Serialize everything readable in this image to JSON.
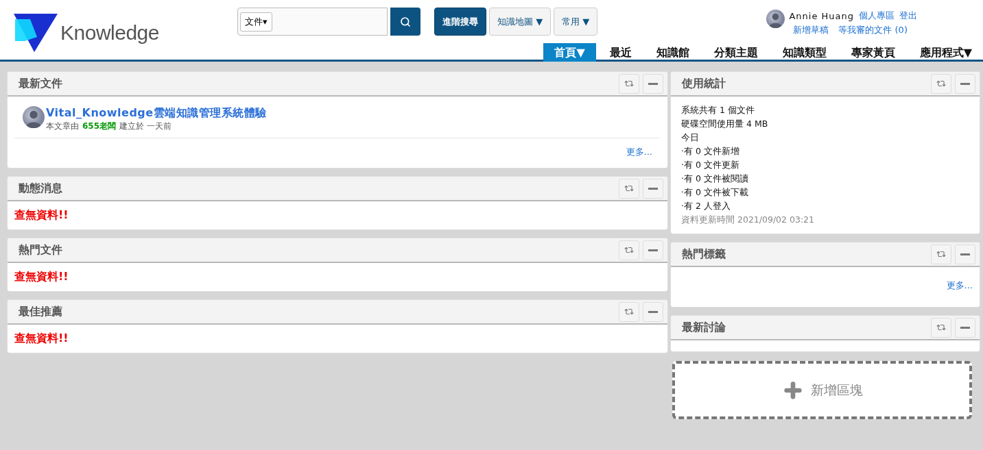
{
  "header": {
    "logo_text": "Knowledge",
    "search": {
      "scope": "文件▾"
    },
    "buttons": [
      {
        "label": "進階搜尋",
        "kind": "primary"
      },
      {
        "label": "知識地圖 ▼",
        "kind": "dropdown"
      },
      {
        "label": "常用 ▼",
        "kind": "dropdown"
      }
    ],
    "user": {
      "name": "Annie Huang",
      "links": [
        "個人專區",
        "登出"
      ],
      "links2": [
        "新增草稿",
        "等我審的文件 (0)"
      ]
    },
    "nav": [
      {
        "label": "首頁▼",
        "selected": true
      },
      {
        "label": "最近",
        "selected": false
      },
      {
        "label": "知識館",
        "selected": false
      },
      {
        "label": "分類主題",
        "selected": false
      },
      {
        "label": "知識類型",
        "selected": false
      },
      {
        "label": "專家黃頁",
        "selected": false
      },
      {
        "label": "應用程式▼",
        "selected": false
      }
    ]
  },
  "left_panels": [
    {
      "title": "最新文件",
      "kind": "documents",
      "documents": [
        {
          "title": "Vital_Knowledge雲端知識管理系統體驗",
          "by": "本文章由",
          "author": "655老闆",
          "created": "建立於 一天前"
        }
      ],
      "more": "更多..."
    },
    {
      "title": "動態消息",
      "kind": "empty",
      "message": "查無資料!!"
    },
    {
      "title": "熱門文件",
      "kind": "empty",
      "message": "查無資料!!"
    },
    {
      "title": "最佳推薦",
      "kind": "empty",
      "message": "查無資料!!"
    }
  ],
  "right_panels": [
    {
      "title": "使用統計",
      "kind": "stats",
      "lines": [
        "系統共有 1 個文件",
        "硬碟空間使用量 4 MB",
        "今日",
        "·有 0 文件新增",
        "·有 0 文件更新",
        "·有 0 文件被閱讀",
        "·有 0 文件被下載",
        "·有 2 人登入"
      ],
      "updated": "資料更新時間 2021/09/02 03:21"
    },
    {
      "title": "熱門標籤",
      "kind": "tags",
      "more": "更多..."
    },
    {
      "title": "最新討論",
      "kind": "blank"
    }
  ],
  "add_block": {
    "label": "新增區塊"
  }
}
